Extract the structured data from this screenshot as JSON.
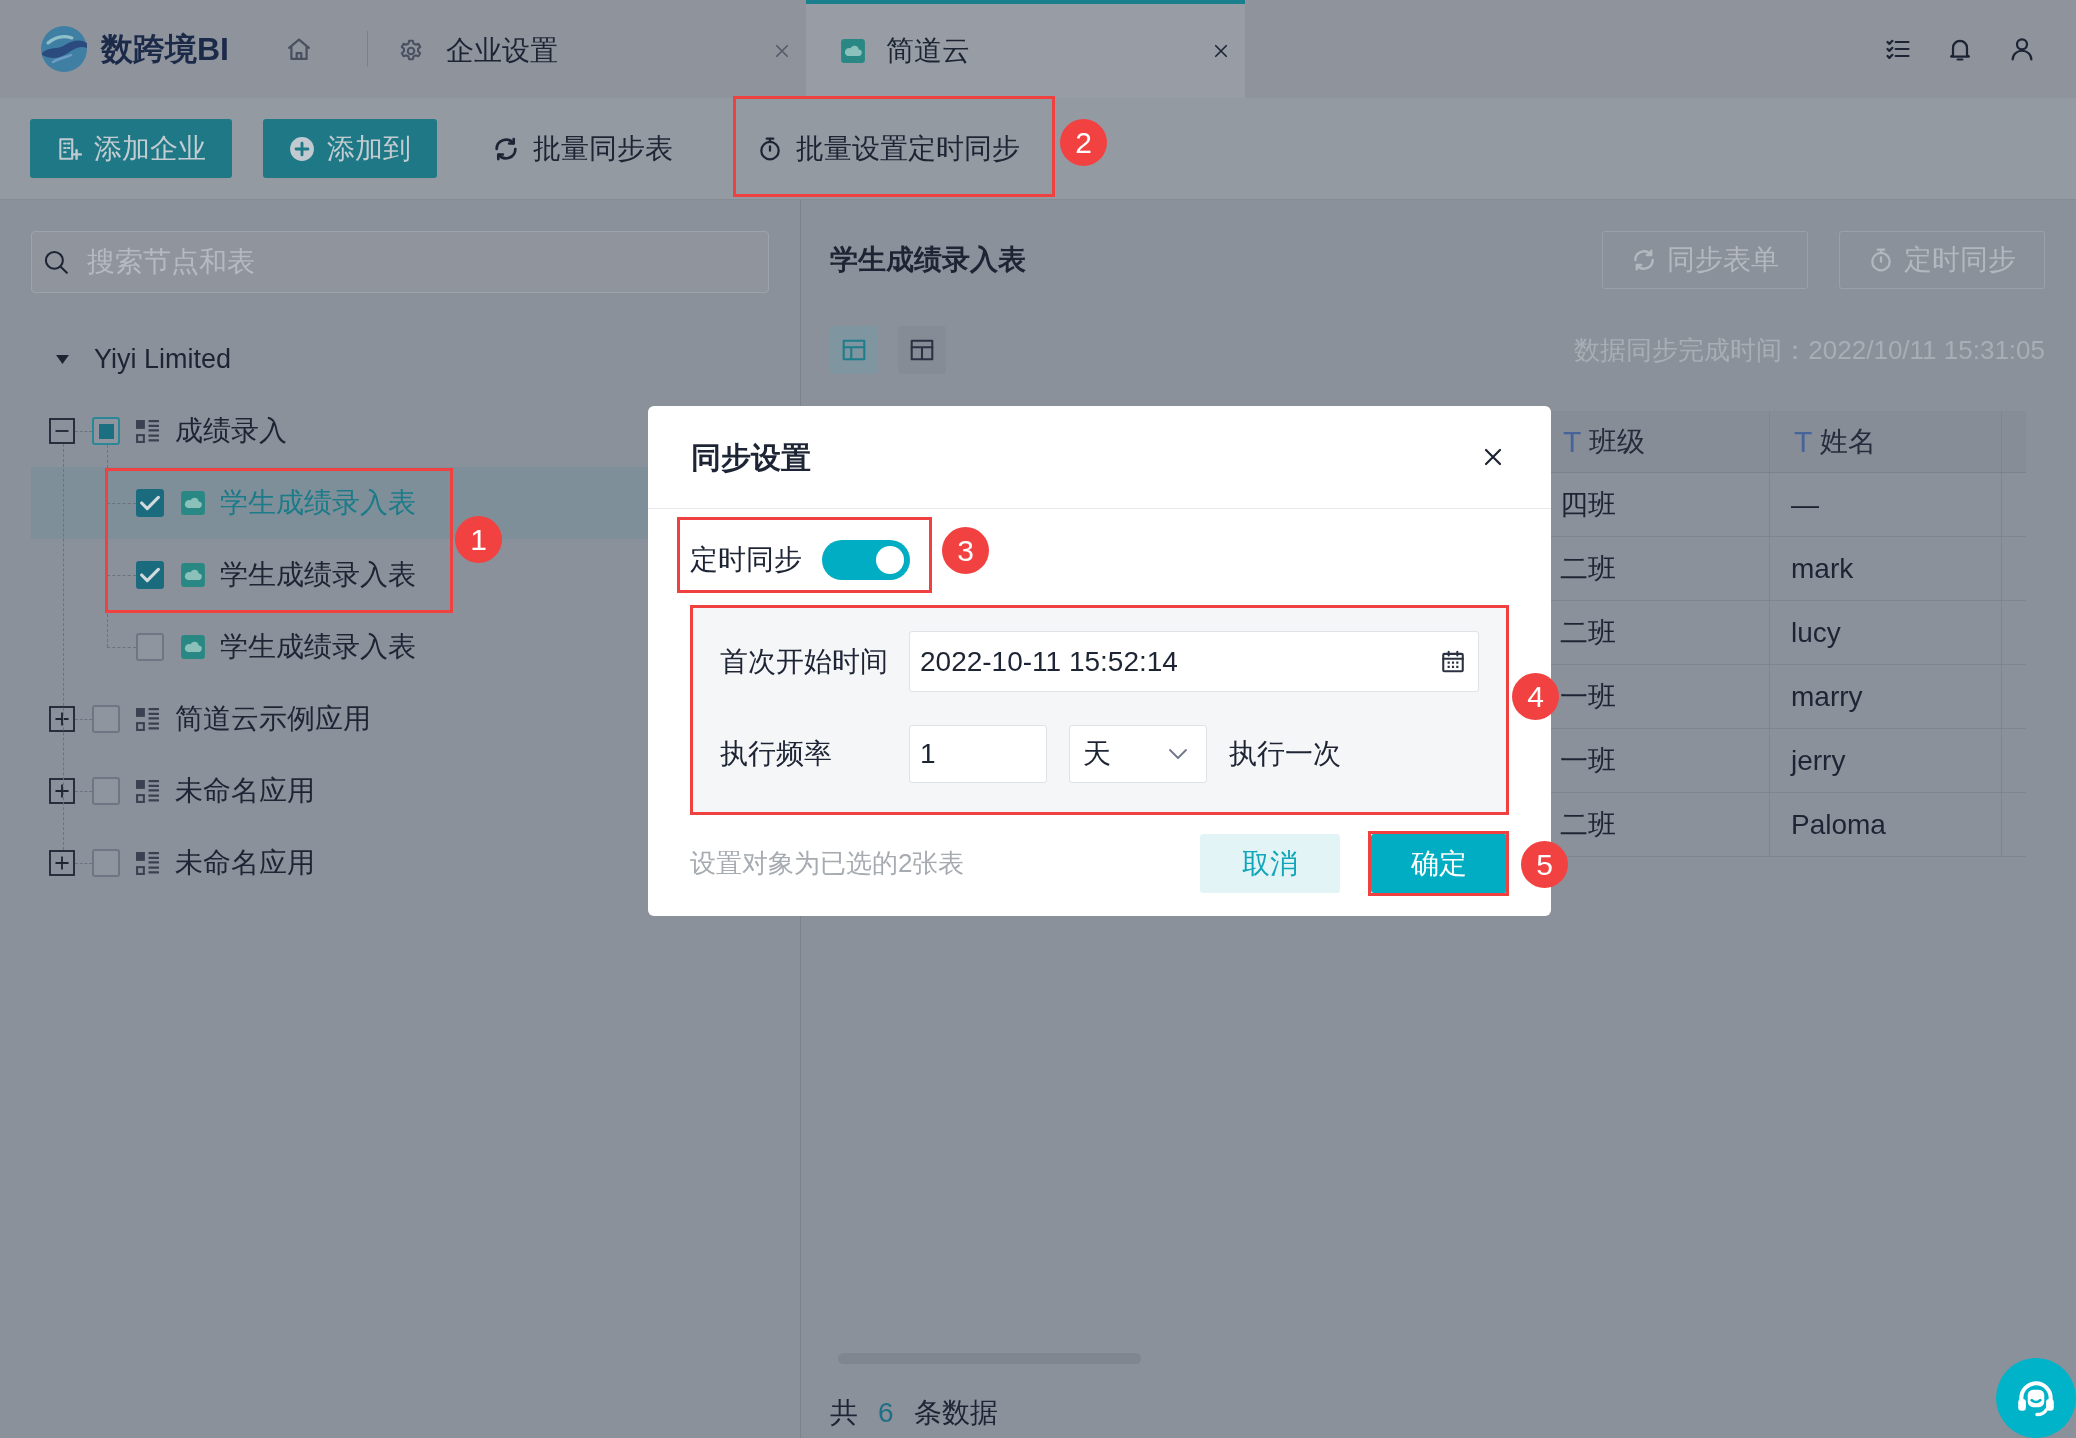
{
  "header": {
    "logo": "数跨境BI",
    "tabs": [
      {
        "label": "企业设置",
        "kind": "settings",
        "selected": false
      },
      {
        "label": "简道云",
        "kind": "app",
        "selected": true
      }
    ]
  },
  "toolbar": {
    "buttons": [
      {
        "label": "添加企业",
        "kind": "primary"
      },
      {
        "label": "添加到",
        "kind": "primary"
      },
      {
        "label": "批量同步表",
        "kind": "plain"
      },
      {
        "label": "批量设置定时同步",
        "kind": "plain"
      }
    ]
  },
  "sidebar": {
    "search": {
      "placeholder": "搜索节点和表"
    },
    "tree": [
      {
        "label": "Yiyi Limited",
        "kind": "company",
        "expanded": true,
        "children": [
          {
            "label": "成绩录入",
            "kind": "app",
            "expanded": true,
            "checked": false,
            "indeterminate": true,
            "children": [
              {
                "label": "学生成绩录入表",
                "kind": "table",
                "checked": true,
                "selected": true
              },
              {
                "label": "学生成绩录入表",
                "kind": "table",
                "checked": true,
                "selected": false
              },
              {
                "label": "学生成绩录入表",
                "kind": "table",
                "checked": false,
                "selected": false
              }
            ]
          },
          {
            "label": "简道云示例应用",
            "kind": "app",
            "expanded": false,
            "checked": false,
            "indeterminate": false
          },
          {
            "label": "未命名应用",
            "kind": "app",
            "expanded": false,
            "checked": false,
            "indeterminate": false
          },
          {
            "label": "未命名应用",
            "kind": "app",
            "expanded": false,
            "checked": false,
            "indeterminate": false
          }
        ]
      }
    ]
  },
  "content": {
    "title": "学生成绩录入表",
    "buttons": [
      {
        "label": "同步表单",
        "disabled": true
      },
      {
        "label": "定时同步",
        "disabled": true
      }
    ],
    "view_toggles": [
      {
        "selected": true
      },
      {
        "selected": false
      }
    ],
    "sync_time": "数据同步完成时间：2022/10/11 15:31:05",
    "table": {
      "columns": [
        {
          "type": "T",
          "label": "班级"
        },
        {
          "type": "T",
          "label": "姓名"
        }
      ],
      "rows": [
        [
          "四班",
          "—"
        ],
        [
          "二班",
          "mark"
        ],
        [
          "二班",
          "lucy"
        ],
        [
          "一班",
          "marry"
        ],
        [
          "一班",
          "jerry"
        ],
        [
          "二班",
          "Paloma"
        ]
      ]
    },
    "total": {
      "prefix": "共",
      "count": "6",
      "suffix": "条数据"
    }
  },
  "dialog": {
    "title": "同步设置",
    "toggle": {
      "label": "定时同步",
      "on": true
    },
    "start_time": {
      "label": "首次开始时间",
      "value": "2022-10-11 15:52:14"
    },
    "frequency": {
      "label": "执行频率",
      "value": "1",
      "unit": "天",
      "suffix": "执行一次"
    },
    "note": "设置对象为已选的2张表",
    "buttons": [
      {
        "label": "取消",
        "kind": "secondary"
      },
      {
        "label": "确定",
        "kind": "primary"
      }
    ]
  },
  "annotations": [
    {
      "label": "1"
    },
    {
      "label": "2"
    },
    {
      "label": "3"
    },
    {
      "label": "4"
    },
    {
      "label": "5"
    }
  ]
}
